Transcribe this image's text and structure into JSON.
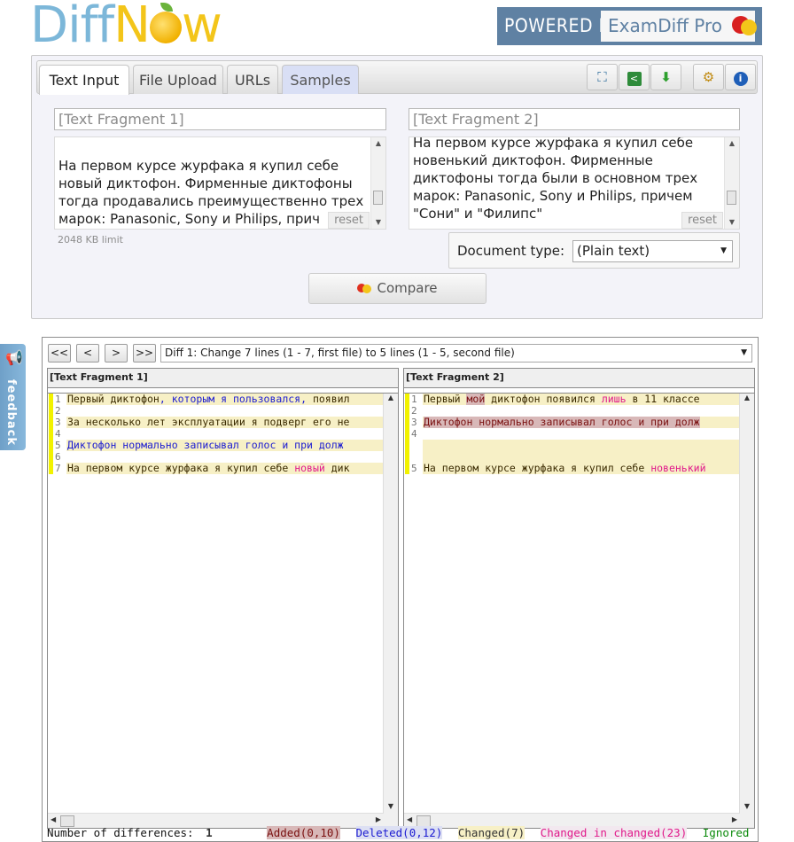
{
  "brand": {
    "logo_part1": "Diff",
    "logo_part2": "N",
    "logo_part3": "w",
    "powered_by": "POWERED BY",
    "examdiff": "ExamDiff Pro"
  },
  "tabs": [
    {
      "label": "Text Input"
    },
    {
      "label": "File Upload"
    },
    {
      "label": "URLs"
    },
    {
      "label": "Samples"
    }
  ],
  "toolbar": {
    "fullscreen_icon": "fullscreen-icon",
    "share_icon": "share-icon",
    "download_icon": "download-icon",
    "settings_icon": "settings-icon",
    "info_icon": "info-icon"
  },
  "input": {
    "left_name_placeholder": "[Text Fragment 1]",
    "right_name_placeholder": "[Text Fragment 2]",
    "left_lines": [
      "",
      "На первом курсе журфака я купил себе",
      "новый диктофон. Фирменные диктофоны",
      "тогда продавались преимущественно трех",
      "марок: Panasonic, Sony и Philips, прич"
    ],
    "right_lines": [
      "На первом курсе журфака я купил себе",
      "новенький диктофон. Фирменные",
      "диктофоны тогда были в основном трех",
      "марок: Panasonic, Sony и Philips, причем",
      "\"Сони\" и \"Филипс\""
    ],
    "reset": "reset",
    "limit": "2048 KB limit",
    "doc_type_label": "Document type:",
    "doc_type_value": "(Plain text)",
    "compare": "Compare"
  },
  "feedback": "feedback",
  "results": {
    "nav": [
      "<<",
      "<",
      ">",
      ">>"
    ],
    "diff_summary": "Diff 1: Change 7 lines (1 - 7, first file) to 5 lines (1 - 5, second file)",
    "left_title": "[Text Fragment 1]",
    "right_title": "[Text Fragment 2]",
    "left_rows": [
      {
        "num": "1",
        "segs": [
          {
            "t": "Первый диктофон",
            "c": "chg"
          },
          {
            "t": ", которым я пользовался,",
            "c": "del"
          },
          {
            "t": " появил",
            "c": "chg"
          }
        ]
      },
      {
        "num": "2",
        "segs": []
      },
      {
        "num": "3",
        "segs": [
          {
            "t": "За несколько лет эксплуатации я подверг его не",
            "c": "chg"
          }
        ]
      },
      {
        "num": "4",
        "segs": []
      },
      {
        "num": "5",
        "segs": [
          {
            "t": "Диктофон нормально записывал голос и при долж",
            "c": "del"
          }
        ]
      },
      {
        "num": "6",
        "segs": []
      },
      {
        "num": "7",
        "segs": [
          {
            "t": "На первом курсе журфака я купил себе ",
            "c": "chg"
          },
          {
            "t": "новый",
            "c": "cic"
          },
          {
            "t": " дик",
            "c": "chg"
          }
        ]
      }
    ],
    "right_rows": [
      {
        "num": "1",
        "segs": [
          {
            "t": "Первый ",
            "c": "chg"
          },
          {
            "t": "мой",
            "c": "add"
          },
          {
            "t": " диктофон появился ",
            "c": "chg"
          },
          {
            "t": "лишь",
            "c": "cic"
          },
          {
            "t": " в 11 классе",
            "c": "chg"
          }
        ]
      },
      {
        "num": "2",
        "segs": []
      },
      {
        "num": "3",
        "segs": [
          {
            "t": "Диктофон нормально записывал голос и при долж",
            "c": "add"
          }
        ]
      },
      {
        "num": "4",
        "segs": []
      },
      {
        "num": "",
        "segs": [
          {
            "t": " ",
            "c": "chg"
          }
        ]
      },
      {
        "num": "",
        "segs": [
          {
            "t": " ",
            "c": "chg"
          }
        ]
      },
      {
        "num": "5",
        "segs": [
          {
            "t": "На первом курсе журфака я купил себе ",
            "c": "chg"
          },
          {
            "t": "новенький",
            "c": "cic"
          }
        ]
      }
    ],
    "legend": {
      "count_label": "Number of differences:",
      "count": "1",
      "added": "Added(0,10)",
      "deleted": "Deleted(0,12)",
      "changed": "Changed(7)",
      "changed_in_changed": "Changed in changed(23)",
      "ignored": "Ignored"
    }
  },
  "colors": {
    "changed_bg": "#f7f0c6",
    "added_bg": "#d8b8b8",
    "deleted_fg": "#1b1bd1",
    "cic_fg": "#e0198a",
    "marker": "#f2f200",
    "ignored_fg": "#0a8a0a"
  }
}
